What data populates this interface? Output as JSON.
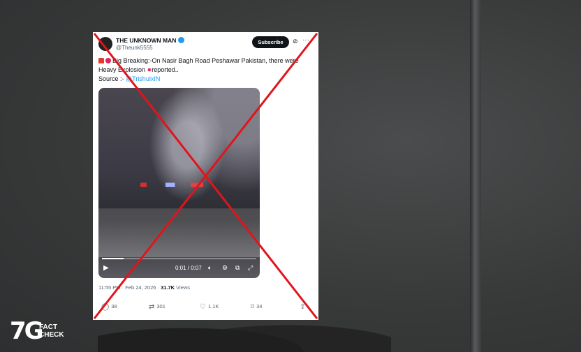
{
  "tweet": {
    "display_name": "THE UNKNOWN MAN",
    "handle": "@Theunk5555",
    "subscribe_label": "Subscribe",
    "line1": "Big Breaking:-On Nasir Bagh Road Peshawar Pakistan, there were",
    "line2a": "Heavy Explosion ",
    "line2b": "reported..",
    "line3a": "Source :- ",
    "source_link": "@TrishulxIN",
    "video_time": "0:01 / 0:07",
    "video_progress": 0.14,
    "timestamp": "11:55 PM · Feb 24, 2026 · ",
    "views_count": "31.7K",
    "views_label": " Views",
    "replies": "38",
    "reposts": "301",
    "likes": "1.1K",
    "bookmarks": "34"
  },
  "icons": {
    "verified": "verified-badge-icon",
    "grok": "grok-icon",
    "more": "more-icon",
    "play": "play-icon",
    "volume": "volume-icon",
    "settings": "settings-icon",
    "pip": "pip-icon",
    "fullscreen": "fullscreen-icon",
    "reply": "reply-icon",
    "repost": "repost-icon",
    "like": "heart-icon",
    "bookmark": "bookmark-icon",
    "share": "share-icon"
  },
  "branding": {
    "logo_number": "7G",
    "logo_word1": "FACT",
    "logo_word2": "CHECK"
  },
  "colors": {
    "cross": "#e0141b",
    "link": "#1d9bf0",
    "subscribe_bg": "#0f1419"
  }
}
